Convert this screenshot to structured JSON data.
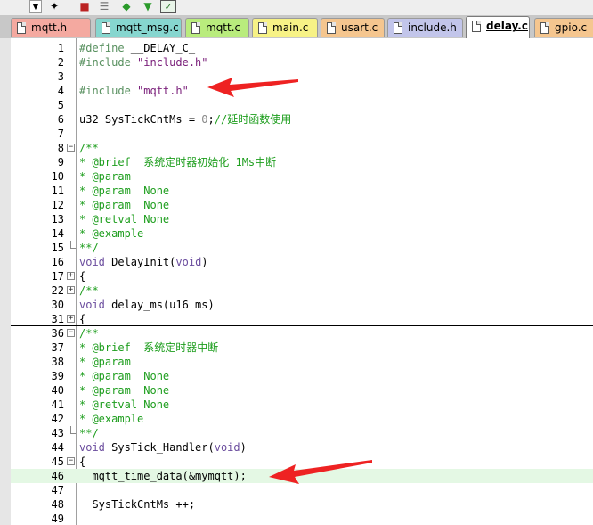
{
  "toolbar": {
    "icons": [
      "dropdown-icon",
      "magic-wand-icon",
      "build-icon",
      "stack-icon",
      "green-down-icon",
      "green-diamond-icon",
      "checklist-icon"
    ]
  },
  "tabs": [
    {
      "label": "mqtt.h",
      "color": "#f4a9a0"
    },
    {
      "label": "mqtt_msg.c",
      "color": "#86d6cf"
    },
    {
      "label": "mqtt.c",
      "color": "#b9ec7d"
    },
    {
      "label": "main.c",
      "color": "#f7f286"
    },
    {
      "label": "usart.c",
      "color": "#f5c68f"
    },
    {
      "label": "include.h",
      "color": "#c2c5ea"
    },
    {
      "label": "delay.c",
      "color": "#ffffff",
      "active": true
    },
    {
      "label": "gpio.c",
      "color": "#f5c68f"
    }
  ],
  "editor": {
    "highlight_color": "#e4f8e4",
    "lines": [
      {
        "num": "1",
        "fold": "",
        "segs": [
          {
            "c": "pp",
            "t": "#define"
          },
          {
            "c": "",
            "t": " __DELAY_C_"
          }
        ]
      },
      {
        "num": "2",
        "fold": "",
        "segs": [
          {
            "c": "pp",
            "t": "#include"
          },
          {
            "c": "",
            "t": " "
          },
          {
            "c": "str",
            "t": "\"include.h\""
          }
        ]
      },
      {
        "num": "3",
        "fold": "",
        "segs": []
      },
      {
        "num": "4",
        "fold": "",
        "segs": [
          {
            "c": "pp",
            "t": "#include"
          },
          {
            "c": "",
            "t": " "
          },
          {
            "c": "str",
            "t": "\"mqtt.h\""
          }
        ]
      },
      {
        "num": "5",
        "fold": "",
        "segs": []
      },
      {
        "num": "6",
        "fold": "",
        "segs": [
          {
            "c": "",
            "t": "u32 SysTickCntMs = "
          },
          {
            "c": "n",
            "t": "0"
          },
          {
            "c": "",
            "t": ";"
          },
          {
            "c": "cm",
            "t": "//延时函数使用"
          }
        ]
      },
      {
        "num": "7",
        "fold": "",
        "segs": []
      },
      {
        "num": "8",
        "fold": "minus",
        "segs": [
          {
            "c": "cm",
            "t": "/**"
          }
        ]
      },
      {
        "num": "9",
        "fold": "",
        "segs": [
          {
            "c": "cm",
            "t": "* @brief  系统定时器初始化 1Ms中断"
          }
        ]
      },
      {
        "num": "10",
        "fold": "",
        "segs": [
          {
            "c": "cm",
            "t": "* @param"
          }
        ]
      },
      {
        "num": "11",
        "fold": "",
        "segs": [
          {
            "c": "cm",
            "t": "* @param  None"
          }
        ]
      },
      {
        "num": "12",
        "fold": "",
        "segs": [
          {
            "c": "cm",
            "t": "* @param  None"
          }
        ]
      },
      {
        "num": "13",
        "fold": "",
        "segs": [
          {
            "c": "cm",
            "t": "* @retval None"
          }
        ]
      },
      {
        "num": "14",
        "fold": "",
        "segs": [
          {
            "c": "cm",
            "t": "* @example"
          }
        ]
      },
      {
        "num": "15",
        "fold": "end",
        "segs": [
          {
            "c": "cm",
            "t": "**/"
          }
        ]
      },
      {
        "num": "16",
        "fold": "",
        "segs": [
          {
            "c": "k",
            "t": "void"
          },
          {
            "c": "",
            "t": " DelayInit("
          },
          {
            "c": "k",
            "t": "void"
          },
          {
            "c": "",
            "t": ")"
          }
        ]
      },
      {
        "num": "17",
        "fold": "plus",
        "div": true,
        "segs": [
          {
            "c": "",
            "t": "{"
          }
        ]
      },
      {
        "num": "22",
        "fold": "plus",
        "segs": [
          {
            "c": "cm",
            "t": "/**"
          }
        ]
      },
      {
        "num": "30",
        "fold": "",
        "segs": [
          {
            "c": "k",
            "t": "void"
          },
          {
            "c": "",
            "t": " delay_ms(u16 ms)"
          }
        ]
      },
      {
        "num": "31",
        "fold": "plus",
        "div": true,
        "segs": [
          {
            "c": "",
            "t": "{"
          }
        ]
      },
      {
        "num": "36",
        "fold": "minus",
        "segs": [
          {
            "c": "cm",
            "t": "/**"
          }
        ]
      },
      {
        "num": "37",
        "fold": "",
        "segs": [
          {
            "c": "cm",
            "t": "* @brief  系统定时器中断"
          }
        ]
      },
      {
        "num": "38",
        "fold": "",
        "segs": [
          {
            "c": "cm",
            "t": "* @param"
          }
        ]
      },
      {
        "num": "39",
        "fold": "",
        "segs": [
          {
            "c": "cm",
            "t": "* @param  None"
          }
        ]
      },
      {
        "num": "40",
        "fold": "",
        "segs": [
          {
            "c": "cm",
            "t": "* @param  None"
          }
        ]
      },
      {
        "num": "41",
        "fold": "",
        "segs": [
          {
            "c": "cm",
            "t": "* @retval None"
          }
        ]
      },
      {
        "num": "42",
        "fold": "",
        "segs": [
          {
            "c": "cm",
            "t": "* @example"
          }
        ]
      },
      {
        "num": "43",
        "fold": "end",
        "segs": [
          {
            "c": "cm",
            "t": "**/"
          }
        ]
      },
      {
        "num": "44",
        "fold": "",
        "segs": [
          {
            "c": "k",
            "t": "void"
          },
          {
            "c": "",
            "t": " SysTick_Handler("
          },
          {
            "c": "k",
            "t": "void"
          },
          {
            "c": "",
            "t": ")"
          }
        ]
      },
      {
        "num": "45",
        "fold": "minus",
        "segs": [
          {
            "c": "",
            "t": "{"
          }
        ]
      },
      {
        "num": "46",
        "fold": "",
        "hl": true,
        "segs": [
          {
            "c": "",
            "t": "  mqtt_time_data(&mymqtt);"
          }
        ]
      },
      {
        "num": "47",
        "fold": "",
        "segs": []
      },
      {
        "num": "48",
        "fold": "",
        "segs": [
          {
            "c": "",
            "t": "  SysTickCntMs ++;"
          }
        ]
      },
      {
        "num": "49",
        "fold": "",
        "segs": []
      }
    ]
  },
  "annotations": [
    {
      "name": "red-arrow-icon",
      "points_to": "#include \"mqtt.h\""
    },
    {
      "name": "red-arrow-icon",
      "points_to": "mqtt_time_data(&mymqtt);"
    }
  ]
}
